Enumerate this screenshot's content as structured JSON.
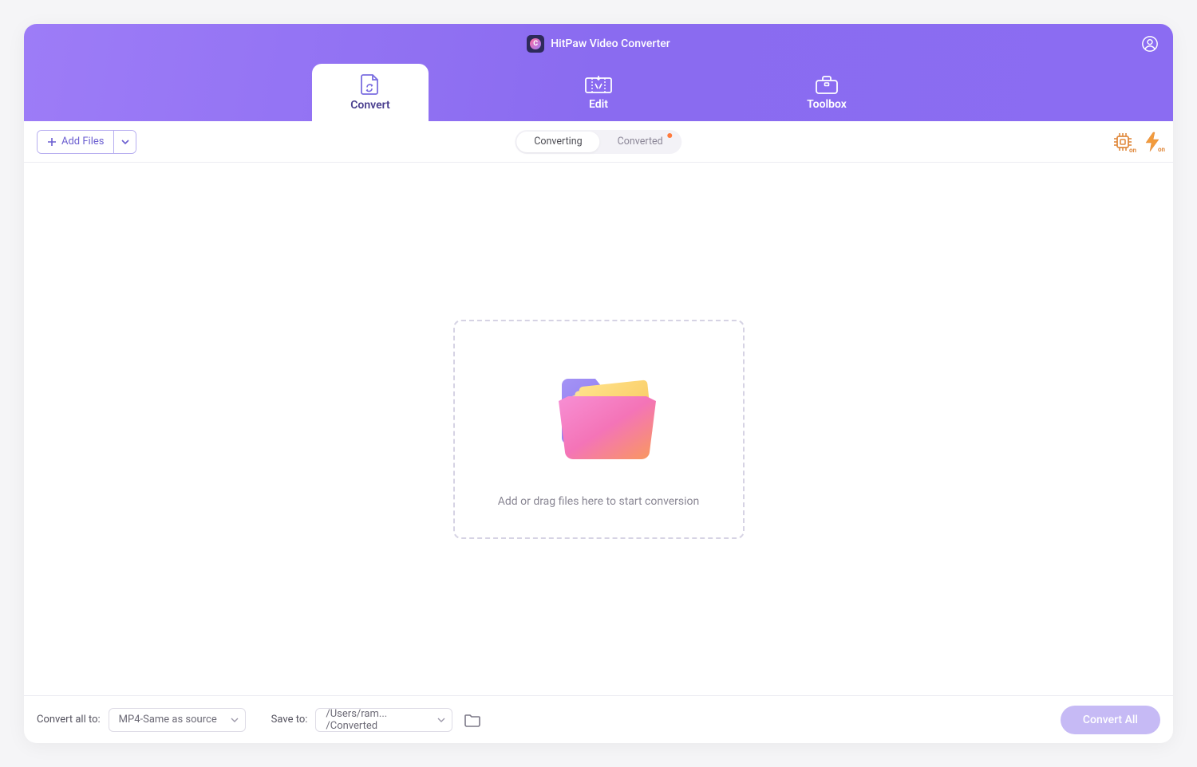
{
  "app": {
    "title": "HitPaw Video Converter",
    "logo_letter": "C"
  },
  "tabs": {
    "convert": "Convert",
    "edit": "Edit",
    "toolbox": "Toolbox"
  },
  "toolbar": {
    "add_files": "Add Files",
    "segments": {
      "converting": "Converting",
      "converted": "Converted"
    },
    "gpu_toggle": "on",
    "lightning_toggle": "on"
  },
  "dropzone": {
    "text": "Add or drag files here to start conversion"
  },
  "footer": {
    "convert_all_label": "Convert all to:",
    "convert_all_value": "MP4-Same as source",
    "save_to_label": "Save to:",
    "save_to_value": "/Users/ram... /Converted",
    "convert_all_button": "Convert All"
  }
}
